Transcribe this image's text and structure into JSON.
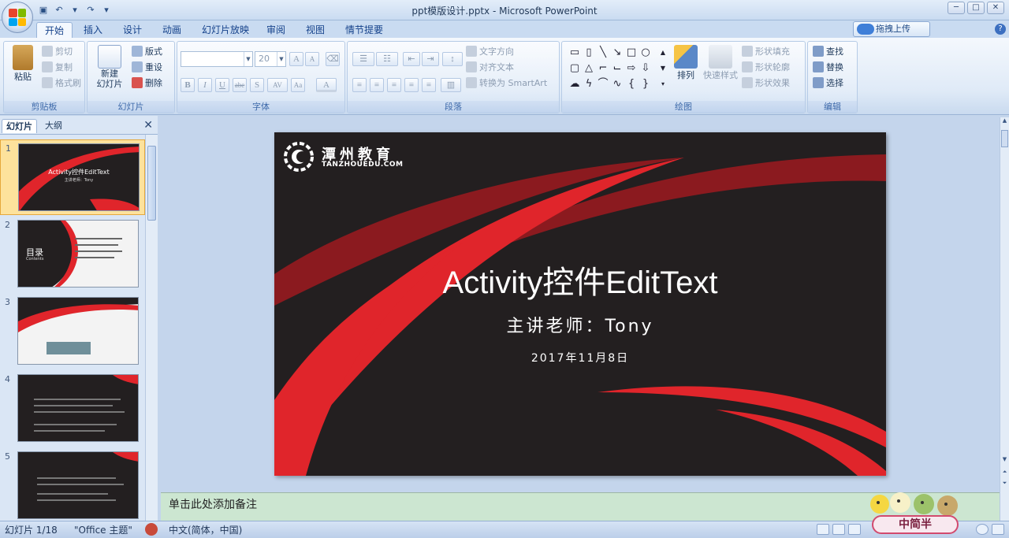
{
  "window": {
    "title": "ppt模版设计.pptx - Microsoft PowerPoint",
    "min_label": "─",
    "max_label": "□",
    "close_label": "✕"
  },
  "tabs": [
    "开始",
    "插入",
    "设计",
    "动画",
    "幻灯片放映",
    "审阅",
    "视图",
    "情节提要"
  ],
  "active_tab": "开始",
  "upload_button": "拖拽上传",
  "ribbon": {
    "clipboard": {
      "label": "剪贴板",
      "paste": "粘贴",
      "cut": "剪切",
      "copy": "复制",
      "format_painter": "格式刷"
    },
    "slides": {
      "label": "幻灯片",
      "new_slide": "新建\n幻灯片",
      "layout": "版式",
      "reset": "重设",
      "delete": "删除"
    },
    "font": {
      "label": "字体",
      "size": "20",
      "bold": "B",
      "italic": "I",
      "underline": "U",
      "strike": "abe",
      "shadow": "S",
      "spacing": "AV",
      "case": "Aa",
      "color": "A",
      "grow": "A",
      "shrink": "A"
    },
    "paragraph": {
      "label": "段落",
      "text_direction": "文字方向",
      "align_text": "对齐文本",
      "smartart": "转换为 SmartArt"
    },
    "drawing": {
      "label": "绘图",
      "arrange": "排列",
      "quick_styles": "快速样式",
      "shape_fill": "形状填充",
      "shape_outline": "形状轮廓",
      "shape_effects": "形状效果"
    },
    "editing": {
      "label": "编辑",
      "find": "查找",
      "replace": "替换",
      "select": "选择"
    }
  },
  "panel": {
    "tabs": [
      "幻灯片",
      "大纲"
    ],
    "close": "✕",
    "thumbnails": [
      {
        "num": "1",
        "title": "Activity控件EditText",
        "sub": "主讲老师：Tony",
        "theme": "dark",
        "selected": true
      },
      {
        "num": "2",
        "title": "目录",
        "sub": "Contents",
        "theme": "light",
        "selected": false
      },
      {
        "num": "3",
        "title": "",
        "sub": "",
        "theme": "light",
        "selected": false
      },
      {
        "num": "4",
        "title": "",
        "sub": "",
        "theme": "dark",
        "selected": false
      },
      {
        "num": "5",
        "title": "",
        "sub": "",
        "theme": "dark",
        "selected": false
      }
    ]
  },
  "slide": {
    "brand": "潭州教育",
    "brand_url": "TANZHOUEDU.COM",
    "title": "Activity控件EditText",
    "subtitle": "主讲老师：Tony",
    "date": "2017年11月8日",
    "bg_color": "#231f20",
    "accent": "#e0252b",
    "accent_dark": "#8b1a1f"
  },
  "notes_placeholder": "单击此处添加备注",
  "status": {
    "slide_counter": "幻灯片 1/18",
    "theme": "\"Office 主题\"",
    "language": "中文(简体，中国)",
    "mascot_label": "中简半"
  }
}
